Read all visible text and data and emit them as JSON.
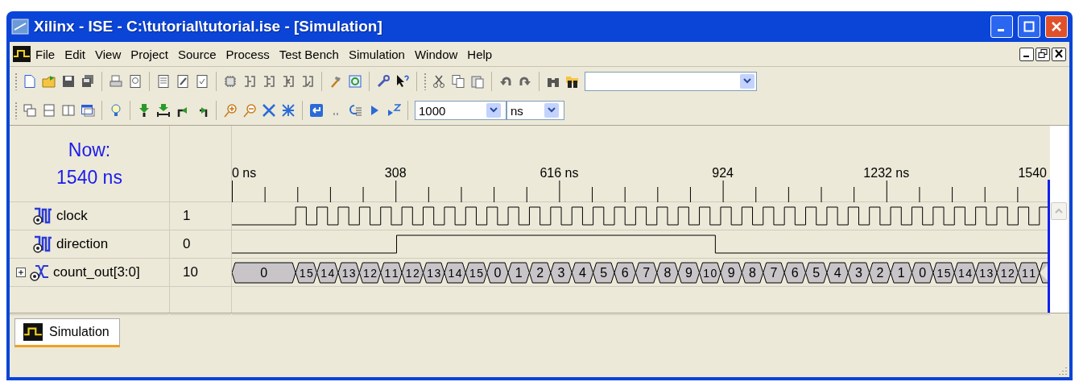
{
  "window": {
    "title": "Xilinx - ISE - C:\\tutorial\\tutorial.ise - [Simulation]"
  },
  "menu": [
    "File",
    "Edit",
    "View",
    "Project",
    "Source",
    "Process",
    "Test Bench",
    "Simulation",
    "Window",
    "Help"
  ],
  "sim_time": {
    "value": "1000",
    "unit": "ns"
  },
  "wave_panel": {
    "now_label": "Now:",
    "now_time": "1540 ns",
    "ruler_labels": [
      "0 ns",
      "308",
      "616 ns",
      "924",
      "1232 ns",
      "1540"
    ],
    "signals": [
      {
        "name": "clock",
        "kind": "clock",
        "value": "1"
      },
      {
        "name": "direction",
        "kind": "bit",
        "value": "0"
      },
      {
        "name": "count_out[3:0]",
        "kind": "bus",
        "value": "10",
        "expanded": false,
        "segments": [
          "0",
          "15",
          "14",
          "13",
          "12",
          "11",
          "12",
          "13",
          "14",
          "15",
          "0",
          "1",
          "2",
          "3",
          "4",
          "5",
          "6",
          "7",
          "8",
          "9",
          "10",
          "9",
          "8",
          "7",
          "6",
          "5",
          "4",
          "3",
          "2",
          "1",
          "0",
          "15",
          "14",
          "13",
          "12",
          "11"
        ]
      }
    ]
  },
  "tabs": [
    {
      "label": "Simulation",
      "selected": true
    }
  ]
}
